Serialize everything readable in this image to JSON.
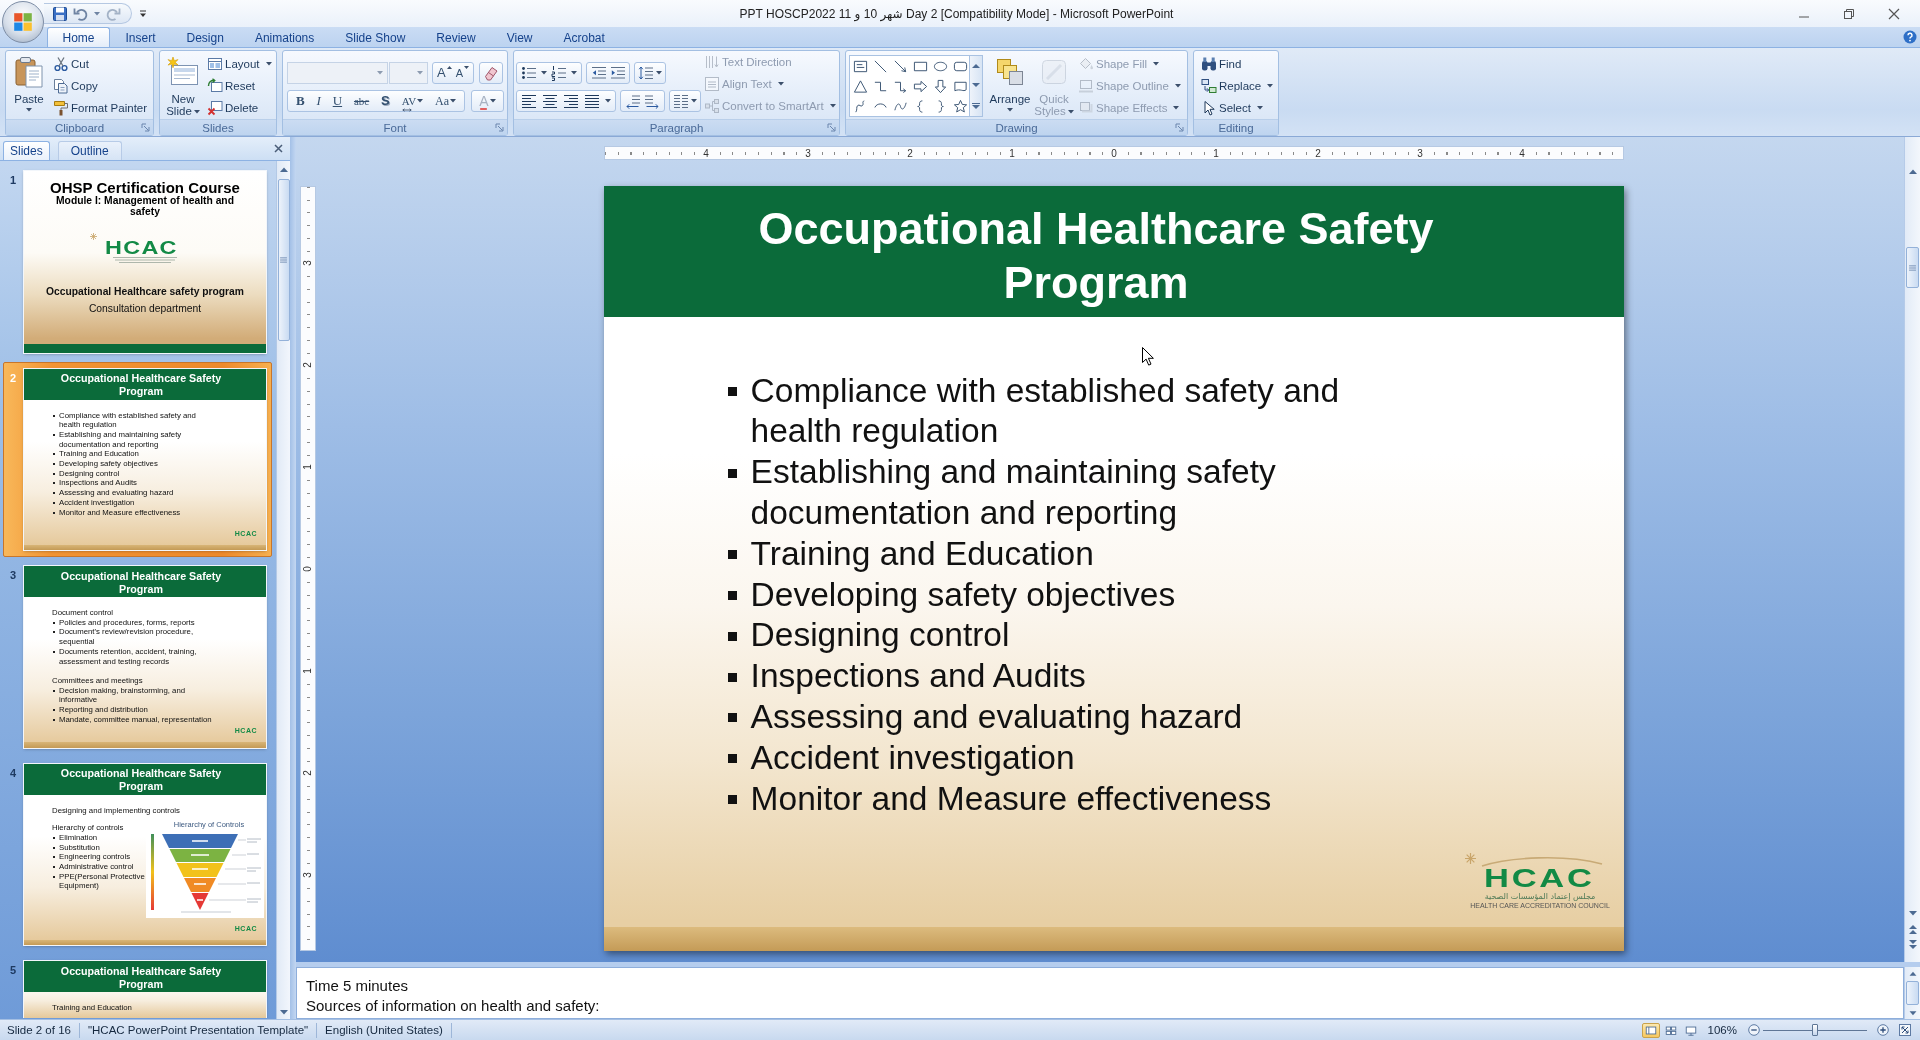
{
  "window": {
    "title": "PPT HOSCP2022 شهر 10 و 11 Day 2 [Compatibility Mode] - Microsoft PowerPoint"
  },
  "ribbon": {
    "tabs": [
      {
        "label": "Home",
        "selected": true
      },
      {
        "label": "Insert",
        "selected": false
      },
      {
        "label": "Design",
        "selected": false
      },
      {
        "label": "Animations",
        "selected": false
      },
      {
        "label": "Slide Show",
        "selected": false
      },
      {
        "label": "Review",
        "selected": false
      },
      {
        "label": "View",
        "selected": false
      },
      {
        "label": "Acrobat",
        "selected": false
      }
    ],
    "groups": [
      {
        "label": "Clipboard",
        "launcher": true,
        "commands": [
          {
            "label": "Paste",
            "disabled": false,
            "dropdown": true
          },
          {
            "label": "Cut",
            "disabled": false,
            "dropdown": false
          },
          {
            "label": "Copy",
            "disabled": false,
            "dropdown": false
          },
          {
            "label": "Format Painter",
            "disabled": false,
            "dropdown": false
          }
        ]
      },
      {
        "label": "Slides",
        "launcher": false,
        "commands": [
          {
            "label": "New Slide",
            "disabled": false,
            "dropdown": true
          },
          {
            "label": "Layout",
            "disabled": false,
            "dropdown": true
          },
          {
            "label": "Reset",
            "disabled": false,
            "dropdown": false
          },
          {
            "label": "Delete",
            "disabled": false,
            "dropdown": false
          }
        ]
      },
      {
        "label": "Font",
        "launcher": true,
        "fields": [
          {
            "disabled": true
          },
          {
            "disabled": true
          }
        ],
        "buttons": [
          {
            "kind": "grow",
            "glyph": "A",
            "disabled": false,
            "dropdown": false
          },
          {
            "kind": "shrink",
            "glyph": "A",
            "disabled": false,
            "dropdown": false
          },
          {
            "kind": "bold",
            "glyph": "B",
            "disabled": false,
            "dropdown": false
          },
          {
            "kind": "italic",
            "glyph": "I",
            "disabled": false,
            "dropdown": false
          },
          {
            "kind": "underline",
            "glyph": "U",
            "disabled": false,
            "dropdown": false
          },
          {
            "kind": "strikethrough",
            "glyph": "abc",
            "disabled": false,
            "dropdown": false
          },
          {
            "kind": "shadow",
            "glyph": "S",
            "disabled": false,
            "dropdown": false
          },
          {
            "kind": "spacing",
            "glyph": "AV",
            "disabled": false,
            "dropdown": true
          },
          {
            "kind": "case",
            "glyph": "Aa",
            "disabled": false,
            "dropdown": true
          },
          {
            "kind": "color",
            "glyph": "A",
            "disabled": true,
            "dropdown": true
          }
        ]
      },
      {
        "label": "Paragraph",
        "launcher": true,
        "commands": [
          {
            "label": "Text Direction",
            "disabled": true,
            "dropdown": false
          },
          {
            "label": "Align Text",
            "disabled": true,
            "dropdown": true
          },
          {
            "label": "Convert to SmartArt",
            "disabled": true,
            "dropdown": true
          }
        ]
      },
      {
        "label": "Drawing",
        "launcher": true,
        "commands": [
          {
            "label": "Arrange",
            "disabled": false,
            "dropdown": true
          },
          {
            "label": "Quick Styles",
            "disabled": true,
            "dropdown": true
          },
          {
            "label": "Shape Fill",
            "disabled": true,
            "dropdown": true
          },
          {
            "label": "Shape Outline",
            "disabled": true,
            "dropdown": true
          },
          {
            "label": "Shape Effects",
            "disabled": true,
            "dropdown": true
          }
        ]
      },
      {
        "label": "Editing",
        "launcher": false,
        "commands": [
          {
            "label": "Find",
            "disabled": false,
            "dropdown": false
          },
          {
            "label": "Replace",
            "disabled": false,
            "dropdown": true
          },
          {
            "label": "Select",
            "disabled": false,
            "dropdown": true
          }
        ]
      }
    ]
  },
  "slides_pane": {
    "tabs": [
      {
        "label": "Slides",
        "selected": true
      },
      {
        "label": "Outline",
        "selected": false
      }
    ],
    "slides": [
      {
        "number": "1",
        "selected": false,
        "kind": "title",
        "title": "OHSP Certification Course",
        "subtitle": "Module I: Management of health and safety",
        "logo": "HCAC",
        "lines": [
          "Occupational Healthcare safety program",
          "Consultation department"
        ]
      },
      {
        "number": "2",
        "selected": true,
        "kind": "content",
        "title": "Occupational Healthcare Safety Program",
        "blocks": [
          {
            "kind": "bullet",
            "text": "Compliance with established safety and health regulation"
          },
          {
            "kind": "bullet",
            "text": "Establishing and maintaining safety documentation and reporting"
          },
          {
            "kind": "bullet",
            "text": "Training and Education"
          },
          {
            "kind": "bullet",
            "text": "Developing safety objectives"
          },
          {
            "kind": "bullet",
            "text": "Designing control"
          },
          {
            "kind": "bullet",
            "text": "Inspections and Audits"
          },
          {
            "kind": "bullet",
            "text": "Assessing and evaluating hazard"
          },
          {
            "kind": "bullet",
            "text": "Accident investigation"
          },
          {
            "kind": "bullet",
            "text": "Monitor and Measure effectiveness"
          }
        ],
        "logo": "HCAC"
      },
      {
        "number": "3",
        "selected": false,
        "kind": "content",
        "title": "Occupational Healthcare Safety Program",
        "blocks": [
          {
            "kind": "heading",
            "text": "Document control"
          },
          {
            "kind": "bullet",
            "text": "Policies and procedures, forms, reports"
          },
          {
            "kind": "bullet",
            "text": "Document's review/revision procedure, sequential"
          },
          {
            "kind": "bullet",
            "text": "Documents retention, accident, training, assessment and testing records"
          },
          {
            "kind": "heading",
            "text": "Committees and meetings"
          },
          {
            "kind": "bullet",
            "text": "Decision making, brainstorming, and informative"
          },
          {
            "kind": "bullet",
            "text": "Reporting and distribution"
          },
          {
            "kind": "bullet",
            "text": "Mandate, committee manual, representation"
          }
        ],
        "logo": "HCAC"
      },
      {
        "number": "4",
        "selected": false,
        "kind": "figure",
        "title": "Occupational Healthcare Safety Program",
        "heading": "Designing and implementing controls",
        "blocks": [
          {
            "kind": "heading",
            "text": "Hierarchy of controls"
          },
          {
            "kind": "bullet",
            "text": "Elimination"
          },
          {
            "kind": "bullet",
            "text": "Substitution"
          },
          {
            "kind": "bullet",
            "text": "Engineering controls"
          },
          {
            "kind": "bullet",
            "text": "Administrative control"
          },
          {
            "kind": "bullet",
            "text": "PPE(Personal Protective Equipment)"
          }
        ],
        "figure": {
          "title": "Hierarchy of Controls"
        },
        "logo": "HCAC"
      },
      {
        "number": "5",
        "selected": false,
        "kind": "content",
        "title": "Occupational Healthcare Safety Program",
        "blocks": [
          {
            "kind": "heading",
            "text": "Training and Education"
          }
        ]
      }
    ]
  },
  "rulers": {
    "horizontal": [
      "4",
      "3",
      "2",
      "1",
      "0",
      "1",
      "2",
      "3",
      "4"
    ],
    "vertical": [
      "3",
      "2",
      "1",
      "0",
      "1",
      "2",
      "3"
    ]
  },
  "slide": {
    "title": "Occupational Healthcare Safety Program",
    "bullets": [
      "Compliance with established safety and health regulation",
      "Establishing and maintaining safety documentation and reporting",
      "Training and Education",
      "Developing safety objectives",
      "Designing control",
      "Inspections and Audits",
      "Assessing and evaluating hazard",
      "Accident investigation",
      "Monitor and Measure effectiveness"
    ],
    "logo": {
      "mark": "HCAC",
      "arabic": "مجلس إعتماد المؤسسات الصحية",
      "english": "HEALTH CARE ACCREDITATION COUNCIL"
    }
  },
  "notes": {
    "lines": [
      "Time 5 minutes",
      "Sources of information on health and safety:"
    ]
  },
  "status_bar": {
    "items": [
      "Slide 2 of 16",
      "\"HCAC PowerPoint Presentation Template\"",
      "English (United States)"
    ],
    "views": [
      {
        "selected": true
      },
      {
        "selected": false
      },
      {
        "selected": false
      }
    ],
    "zoom": "106%",
    "zoom_slider": {
      "level": 0.5
    }
  }
}
